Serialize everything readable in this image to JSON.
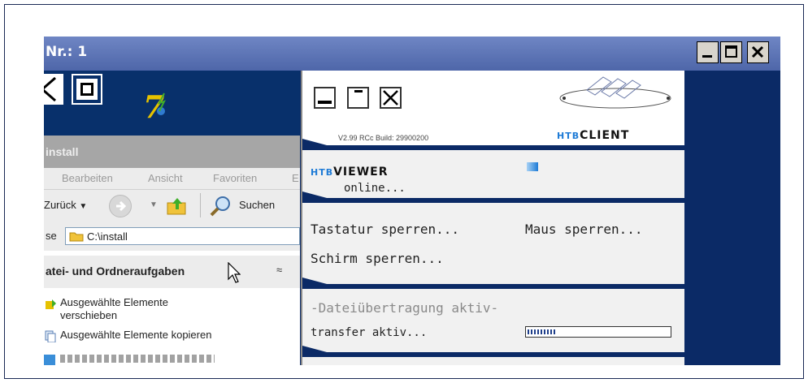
{
  "window": {
    "title": "Nr.: 1",
    "controls": [
      "minimize",
      "maximize",
      "close"
    ]
  },
  "explorer": {
    "logo_text": "7",
    "title": "install",
    "menu": [
      "Bearbeiten",
      "Ansicht",
      "Favoriten",
      "E"
    ],
    "toolbar": {
      "back_label": "Zurück",
      "search_label": "Suchen"
    },
    "address": {
      "label": "se",
      "value": "C:\\install"
    },
    "tasks": {
      "header": "atei- und Ordneraufgaben",
      "items": [
        "Ausgewählte Elemente verschieben",
        "Ausgewählte Elemente kopieren"
      ]
    }
  },
  "htb": {
    "version": "V2.99 RCc Build: 29900200",
    "brand": {
      "prefix": "HTB",
      "name": "CLIENT"
    },
    "viewer": {
      "prefix": "HTB",
      "name": "VIEWER",
      "status": "online..."
    },
    "actions": {
      "keyboard": "Tastatur sperren...",
      "mouse": "Maus sperren...",
      "screen": "Schirm sperren..."
    },
    "transfer": {
      "heading": "-Dateiübertragung aktiv-",
      "status": "transfer aktiv...",
      "progress": 0.2
    }
  },
  "colors": {
    "navy": "#0b2a66",
    "titlebar": "#5a72b5",
    "accent": "#1e7bd6"
  }
}
